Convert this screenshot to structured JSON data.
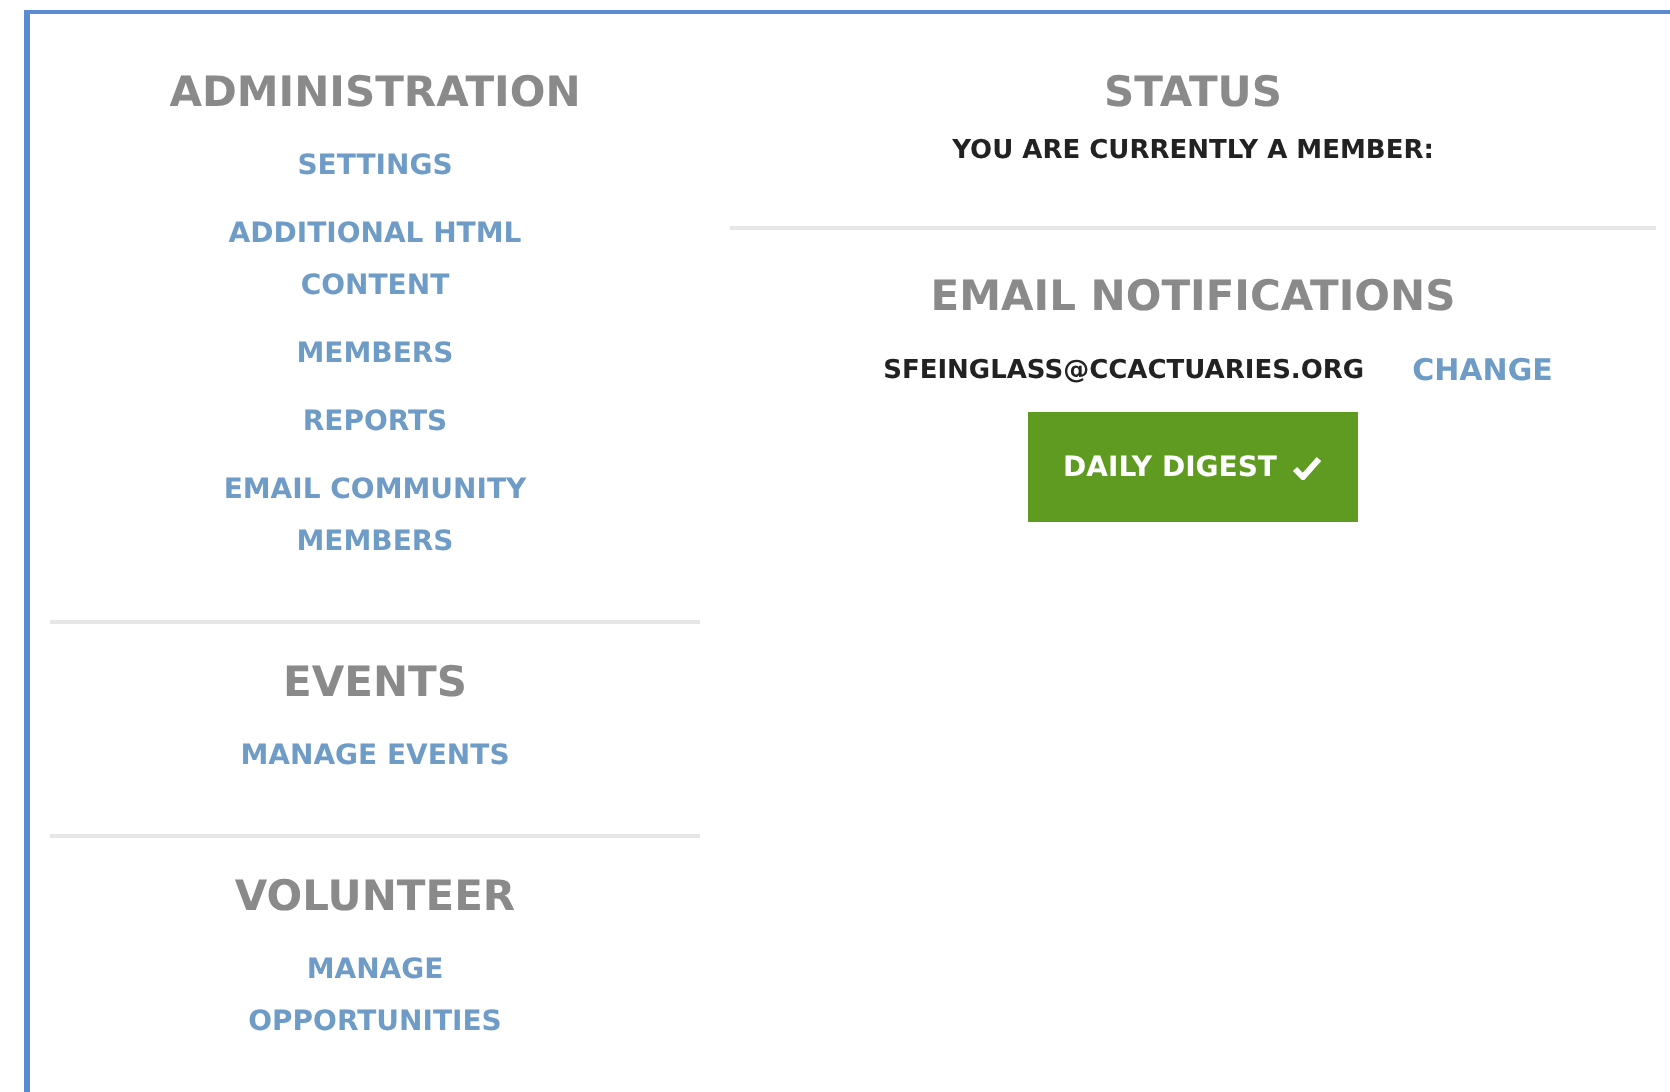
{
  "sections": [
    {
      "title": "ADMINISTRATION",
      "links": [
        "SETTINGS",
        "ADDITIONAL HTML CONTENT",
        "MEMBERS",
        "REPORTS",
        "EMAIL COMMUNITY MEMBERS"
      ]
    },
    {
      "title": "EVENTS",
      "links": [
        "MANAGE EVENTS"
      ]
    },
    {
      "title": "VOLUNTEER",
      "links": [
        "MANAGE OPPORTUNITIES"
      ]
    }
  ],
  "status": {
    "title": "STATUS",
    "text": "YOU ARE CURRENTLY A MEMBER:"
  },
  "notifications": {
    "title": "EMAIL NOTIFICATIONS",
    "email": "SFEINGLASS@CCACTUARIES.ORG",
    "change": "CHANGE",
    "option": {
      "label": "DAILY DIGEST",
      "selected": true
    }
  }
}
